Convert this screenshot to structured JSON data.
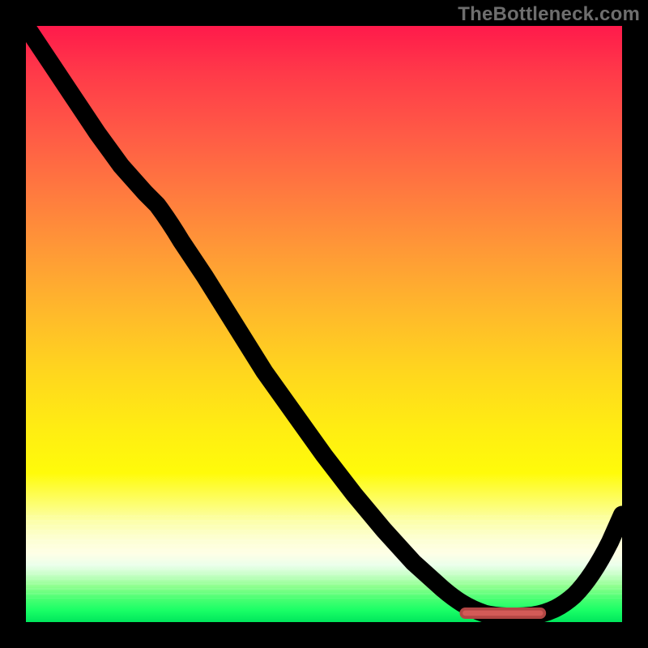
{
  "attribution": "TheBottleneck.com",
  "chart_data": {
    "type": "line",
    "title": "",
    "xlabel": "",
    "ylabel": "",
    "xlim": [
      0,
      100
    ],
    "ylim": [
      0,
      100
    ],
    "x": [
      0,
      5,
      10,
      15,
      20,
      25,
      30,
      35,
      40,
      45,
      50,
      55,
      60,
      65,
      70,
      73,
      76,
      79,
      82,
      85,
      88,
      91,
      94,
      97,
      100
    ],
    "values": [
      100,
      93,
      86,
      79,
      73,
      68,
      61,
      53,
      45,
      37,
      30,
      23,
      17,
      11,
      6,
      3,
      1,
      0,
      0,
      0,
      1,
      3,
      7,
      13,
      20
    ],
    "marker": {
      "x_start": 74,
      "x_end": 87,
      "y": 1.2,
      "color": "#d25a57"
    },
    "gradient_stops": [
      {
        "pct": 0,
        "color": "#ff1a4b"
      },
      {
        "pct": 50,
        "color": "#ffc820"
      },
      {
        "pct": 80,
        "color": "#fffb0a"
      },
      {
        "pct": 100,
        "color": "#00e65c"
      }
    ]
  }
}
